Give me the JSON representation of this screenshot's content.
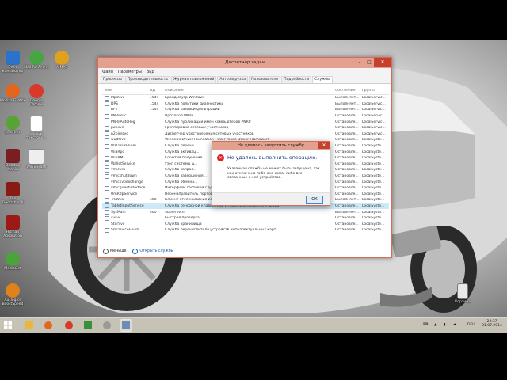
{
  "desktop": {
    "icons": [
      {
        "label": "Этот компьютер",
        "color": "#2b72c9"
      },
      {
        "label": "Mail.Ru Агент",
        "color": "#47a641"
      },
      {
        "label": "AIMP3",
        "color": "#e0a21c"
      },
      {
        "label": "Mozilla Firefox",
        "color": "#e3661d"
      },
      {
        "label": "Google Chrome",
        "color": "#d9382b"
      },
      {
        "label": "µTorrent",
        "color": "#57a336"
      },
      {
        "label": "Новый текстово...",
        "color": "#ffffff"
      },
      {
        "label": "Desktop Mania",
        "color": "#7a1e22"
      },
      {
        "label": "WinToFlash",
        "color": "#eeeeee"
      },
      {
        "label": "The Godfather II",
        "color": "#8a1a14"
      },
      {
        "label": "Hitman Absolution",
        "color": "#9b1a15"
      },
      {
        "label": "MediaGet",
        "color": "#4aa33b"
      },
      {
        "label": "Auslogics BoostSpeed",
        "color": "#e0811b"
      },
      {
        "label": "Корзина",
        "color": "#e8e8e8"
      }
    ]
  },
  "task_manager": {
    "title": "Диспетчер задач",
    "menu": [
      "Файл",
      "Параметры",
      "Вид"
    ],
    "tabs": [
      "Процессы",
      "Производительность",
      "Журнал приложений",
      "Автозагрузка",
      "Пользователи",
      "Подробности",
      "Службы"
    ],
    "active_tab": "Службы",
    "columns": [
      "Имя",
      "ИД",
      "Описание",
      "Состояние",
      "Группа"
    ],
    "rows": [
      [
        "MpsSvc",
        "1544",
        "Брандмауэр Windows",
        "Выполняет...",
        "LocalServic..."
      ],
      [
        "DPS",
        "1544",
        "Служба политики диагностики",
        "Выполняет...",
        "LocalServic..."
      ],
      [
        "BFE",
        "1544",
        "Служба базовой фильтрации",
        "Выполняет...",
        "LocalServic..."
      ],
      [
        "PNRPsvc",
        "",
        "Протокол PNRP",
        "Остановле...",
        "LocalServic..."
      ],
      [
        "PNRPAutoReg",
        "",
        "Служба публикации имен компьютеров PNRP",
        "Остановле...",
        "LocalServic..."
      ],
      [
        "p2psvc",
        "",
        "Группировка сетевых участников",
        "Остановле...",
        "LocalServic..."
      ],
      [
        "p2pimsvc",
        "",
        "Диспетчер удостоверения сетевых участников",
        "Остановле...",
        "LocalServic..."
      ],
      [
        "wudfsvc",
        "",
        "Windows Driver Foundation - User-mode Driver Framework",
        "Остановле...",
        "LocalSyste..."
      ],
      [
        "WPDBusEnum",
        "",
        "Служба перечи...",
        "Остановле...",
        "LocalSyste..."
      ],
      [
        "WiaRpc",
        "",
        "Служба активац...",
        "Остановле...",
        "LocalSyste..."
      ],
      [
        "WinRM",
        "",
        "События получения...",
        "Остановле...",
        "LocalSyste..."
      ],
      [
        "WalletService",
        "",
        "Узел системы д...",
        "Остановле...",
        "LocalSyste..."
      ],
      [
        "vmicvss",
        "",
        "Служба запрос...",
        "Остановле...",
        "LocalSyste..."
      ],
      [
        "vmicshutdown",
        "",
        "Служба завершения...",
        "Остановле...",
        "LocalSyste..."
      ],
      [
        "vmickvpexchange",
        "",
        "Служба обмена...",
        "Остановле...",
        "LocalSyste..."
      ],
      [
        "vmicguestinterface",
        "",
        "Интерфейс гостевой службы Hyper-V",
        "Остановле...",
        "LocalSyste..."
      ],
      [
        "UmRdpService",
        "",
        "Перенаправитель портов пользовательского режима служб удаленных столов",
        "Остановле...",
        "LocalSyste..."
      ],
      [
        "TrkWks",
        "460",
        "Клиент отслеживания изменившихся связей",
        "Выполняет...",
        "LocalSyste..."
      ],
      [
        "TabletInputService",
        "",
        "Служба сенсорной клавиатуры и панели рукописного ввода",
        "Остановле...",
        "LocalSyste..."
      ],
      [
        "SysMain",
        "460",
        "Superfetch",
        "Выполняет...",
        "LocalSyste..."
      ],
      [
        "svsvc",
        "",
        "Быстрая проверка",
        "Остановле...",
        "LocalSyste..."
      ],
      [
        "StorSvc",
        "",
        "Служба хранилища",
        "Остановле...",
        "LocalSyste..."
      ],
      [
        "SmDeviceEnum",
        "",
        "Служба перечислителя устройств интеллектуальных карт",
        "Остановле...",
        "LocalSyste..."
      ]
    ],
    "selected_row": 18,
    "footer": {
      "less_label": "Меньше",
      "open_services_label": "Открыть службы"
    }
  },
  "error_dialog": {
    "title": "Не удалось запустить службу",
    "heading": "Не удалось выполнить операцию.",
    "body": "Указанная служба не может быть запущена, так как отключена либо она сама, либо все связанные с ней устройства.",
    "ok_label": "ОК"
  },
  "taskbar": {
    "buttons": [
      {
        "name": "file-explorer",
        "color": "#e8b73c"
      },
      {
        "name": "firefox",
        "color": "#e3661d"
      },
      {
        "name": "chrome",
        "color": "#d9382b"
      },
      {
        "name": "store",
        "color": "#3a8f3a"
      },
      {
        "name": "settings",
        "color": "#9a9a9a"
      },
      {
        "name": "task-manager",
        "color": "#6c8cb5"
      }
    ],
    "language": "DEU",
    "time": "23:37",
    "date": "01.07.2014"
  }
}
